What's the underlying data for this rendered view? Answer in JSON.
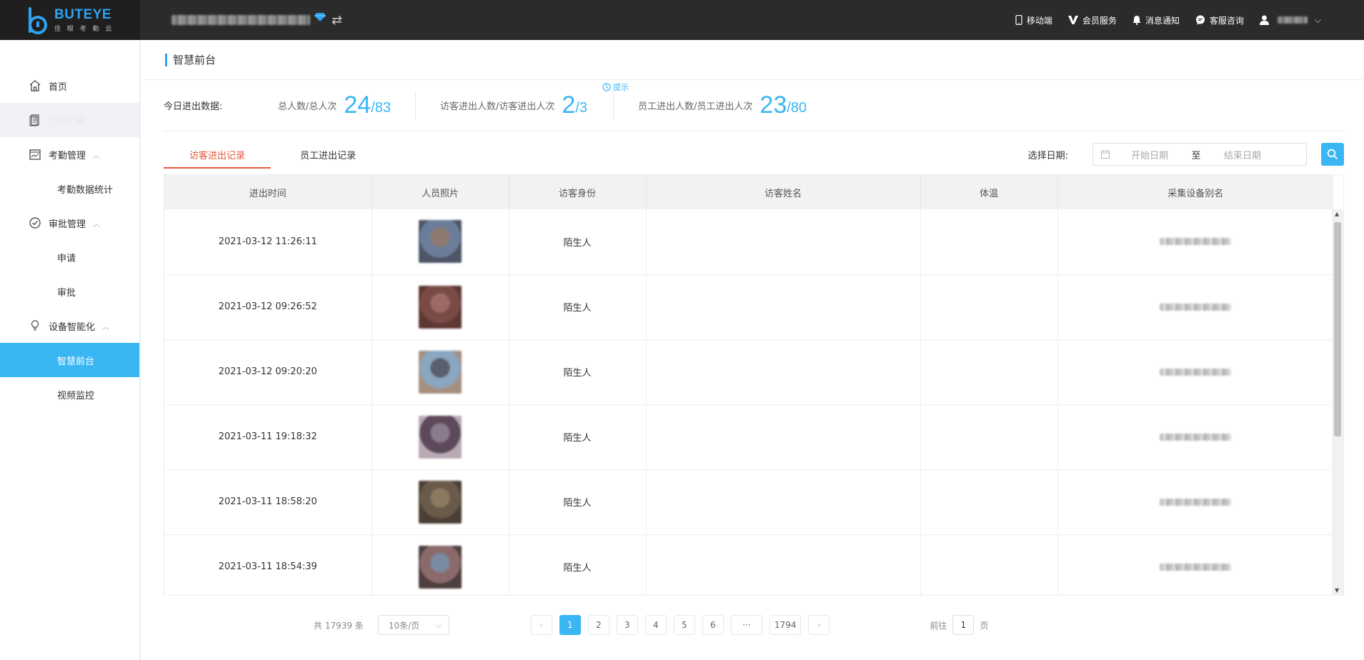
{
  "header": {
    "brand_prefix": "BUT",
    "brand_suffix": "EYE",
    "brand_sub": "佳 眼 考 勤 云",
    "nav": [
      {
        "label": "移动端",
        "icon": "mobile-icon"
      },
      {
        "label": "会员服务",
        "icon": "vip-icon"
      },
      {
        "label": "消息通知",
        "icon": "bell-icon"
      },
      {
        "label": "客服咨询",
        "icon": "chat-icon"
      }
    ]
  },
  "sidebar": {
    "home": "首页",
    "work_report": "工作汇报",
    "attendance": "考勤管理",
    "attendance_stats": "考勤数据统计",
    "approval": "审批管理",
    "apply": "申请",
    "approve": "审批",
    "device": "设备智能化",
    "front_desk": "智慧前台",
    "video": "视频监控"
  },
  "page": {
    "title": "智慧前台"
  },
  "stats": {
    "label": "今日进出数据:",
    "total_label": "总人数/总人次",
    "total_count": "24",
    "total_times": "/83",
    "visitor_label": "访客进出人数/访客进出人次",
    "visitor_count": "2",
    "visitor_times": "/3",
    "hint": "提示",
    "employee_label": "员工进出人数/员工进出人次",
    "employee_count": "23",
    "employee_times": "/80"
  },
  "tabs": {
    "visitor": "访客进出记录",
    "employee": "员工进出记录"
  },
  "filter": {
    "date_label": "选择日期:",
    "start_placeholder": "开始日期",
    "separator": "至",
    "end_placeholder": "结束日期"
  },
  "table": {
    "columns": [
      "进出时间",
      "人员照片",
      "访客身份",
      "访客姓名",
      "体温",
      "采集设备别名"
    ],
    "rows": [
      {
        "time": "2021-03-12 11:26:11",
        "identity": "陌生人",
        "name": "",
        "temperature": "",
        "photo_colors": [
          "#6b7d9a",
          "#8d7a6e",
          "#4d5566"
        ]
      },
      {
        "time": "2021-03-12 09:26:52",
        "identity": "陌生人",
        "name": "",
        "temperature": "",
        "photo_colors": [
          "#7a4a45",
          "#9c6b66",
          "#5e3733"
        ]
      },
      {
        "time": "2021-03-12 09:20:20",
        "identity": "陌生人",
        "name": "",
        "temperature": "",
        "photo_colors": [
          "#8aa6c0",
          "#5b5e6e",
          "#a58f80"
        ]
      },
      {
        "time": "2021-03-11 19:18:32",
        "identity": "陌生人",
        "name": "",
        "temperature": "",
        "photo_colors": [
          "#5c4a5a",
          "#8a7a8e",
          "#b9aab6"
        ]
      },
      {
        "time": "2021-03-11 18:58:20",
        "identity": "陌生人",
        "name": "",
        "temperature": "",
        "photo_colors": [
          "#6a5a4a",
          "#8a7a60",
          "#4a3f35"
        ]
      },
      {
        "time": "2021-03-11 18:54:39",
        "identity": "陌生人",
        "name": "",
        "temperature": "",
        "photo_colors": [
          "#8a6a6a",
          "#7a8aa0",
          "#4e3e3e"
        ]
      }
    ]
  },
  "pagination": {
    "total": "共 17939 条",
    "page_size": "10条/页",
    "pages": [
      "1",
      "2",
      "3",
      "4",
      "5",
      "6",
      "···",
      "1794"
    ],
    "current": "1",
    "goto_label": "前往",
    "goto_value": "1",
    "page_suffix": "页"
  },
  "colors": {
    "accent": "#3ab6f5",
    "tab_active": "#e8563a",
    "topbar": "#2b2b2b"
  }
}
